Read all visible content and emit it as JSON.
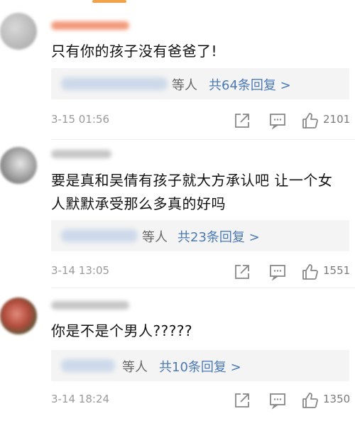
{
  "comments": [
    {
      "text": "只有你的孩子没有爸爸了!",
      "reply_suffix": "等人",
      "reply_link": "共64条回复 >",
      "time": "3-15 01:56",
      "likes": "2101"
    },
    {
      "text": "要是真和吴倩有孩子就大方承认吧 让一个女人默默承受那么多真的好吗",
      "reply_suffix": "等人",
      "reply_link": "共23条回复 >",
      "time": "3-14 13:05",
      "likes": "1551"
    },
    {
      "text": "你是不是个男人?????",
      "reply_suffix": "等人",
      "reply_link": "共10条回复 >",
      "time": "3-14 18:24",
      "likes": "1350"
    }
  ],
  "icons": [
    "share-icon",
    "comment-icon",
    "like-icon"
  ],
  "colors": {
    "link": "#4a79b6",
    "accent": "#f0a34a",
    "meta": "#9a9a9a"
  }
}
